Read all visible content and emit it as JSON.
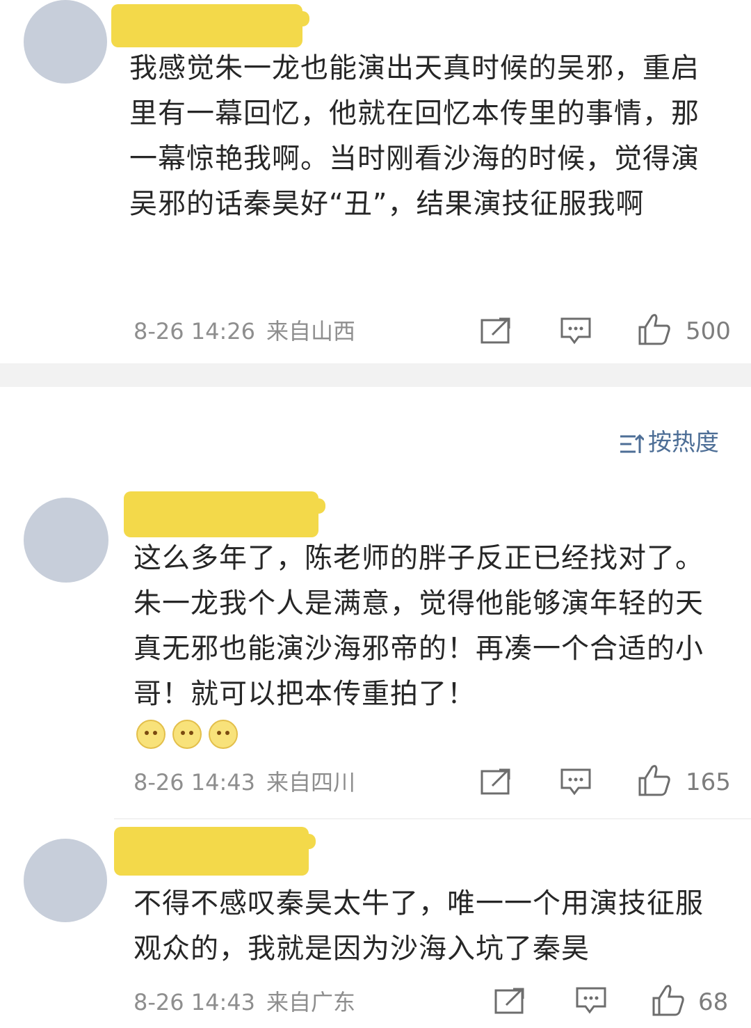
{
  "comments": [
    {
      "text": "我感觉朱一龙也能演出天真时候的吴邪，重启里有一幕回忆，他就在回忆本传里的事情，那一幕惊艳我啊。当时刚看沙海的时候，觉得演吴邪的话秦昊好“丑”，结果演技征服我啊",
      "date": "8-26 14:26",
      "location": "来自山西",
      "likes": "500"
    },
    {
      "text": "这么多年了，陈老师的胖子反正已经找对了。朱一龙我个人是满意，觉得他能够演年轻的天真无邪也能演沙海邪帝的！再凑一个合适的小哥！就可以把本传重拍了！",
      "date": "8-26 14:43",
      "location": "来自四川",
      "likes": "165",
      "emojis": [
        "cute-emoji",
        "cute-emoji",
        "cute-emoji"
      ]
    },
    {
      "text": "不得不感叹秦昊太牛了，唯一一个用演技征服观众的，我就是因为沙海入坑了秦昊",
      "date": "8-26 14:43",
      "location": "来自广东",
      "likes": "68"
    }
  ],
  "sort_label": "按热度",
  "icons": {
    "share": "share-icon",
    "comment": "comment-icon",
    "like": "like-icon",
    "sort": "sort-icon"
  },
  "colors": {
    "avatar": "#c7ceda",
    "redaction": "#f3d94a",
    "text": "#262626",
    "meta": "#8e8e8e",
    "link": "#4d6e96"
  }
}
